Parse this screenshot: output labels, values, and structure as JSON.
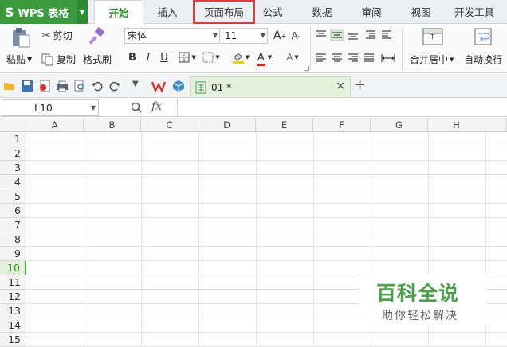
{
  "app": {
    "logo": "S",
    "name": "WPS 表格",
    "menu_caret": "▼"
  },
  "tabs": [
    {
      "label": "开始",
      "active": true
    },
    {
      "label": "插入"
    },
    {
      "label": "页面布局",
      "highlighted": true
    },
    {
      "label": "公式"
    },
    {
      "label": "数据"
    },
    {
      "label": "审阅"
    },
    {
      "label": "视图"
    },
    {
      "label": "开发工具"
    }
  ],
  "ribbon": {
    "paste": "粘贴",
    "cut": "剪切",
    "copy": "复制",
    "format_painter": "格式刷",
    "font_name": "宋体",
    "font_size": "11",
    "merge_center": "合并居中",
    "wrap_text": "自动换行"
  },
  "doc_tab": {
    "name": "01 *",
    "close": "×",
    "new": "+"
  },
  "formula": {
    "cell_ref": "L10",
    "fx": "fx"
  },
  "grid": {
    "columns": [
      "A",
      "B",
      "C",
      "D",
      "E",
      "F",
      "G",
      "H"
    ],
    "rows": [
      "1",
      "2",
      "3",
      "4",
      "5",
      "6",
      "7",
      "8",
      "9",
      "10",
      "11",
      "12",
      "13",
      "14",
      "15"
    ],
    "selected_row": "10"
  },
  "watermark": {
    "title": "百科全说",
    "subtitle": "助你轻松解决"
  },
  "colors": {
    "accent": "#3a9a3c",
    "highlight_box": "#e0393e",
    "selected_row_bg": "#e3efdb"
  }
}
